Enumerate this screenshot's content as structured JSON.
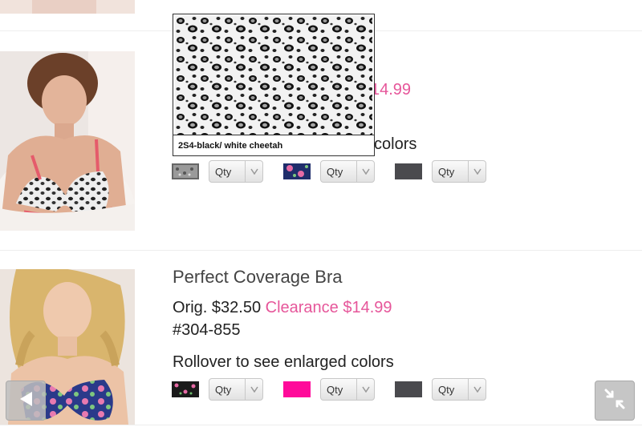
{
  "products": [
    {
      "title": "",
      "orig_price": "",
      "clearance_price": "14.99",
      "sku": "",
      "rollover_text": "colors",
      "qty_label": "Qty",
      "swatches": [
        {
          "name": "2S4-black/ white cheetah",
          "color": "#888888",
          "selected": true
        },
        {
          "name": "navy floral",
          "color": "#1f2d6b"
        },
        {
          "name": "charcoal",
          "color": "#4a4a4e"
        }
      ]
    },
    {
      "title": "Perfect Coverage Bra",
      "orig_price": "Orig. $32.50",
      "clearance_price": "Clearance $14.99",
      "sku": "#304-855",
      "rollover_text": "Rollover to see enlarged colors",
      "qty_label": "Qty",
      "swatches": [
        {
          "name": "black floral",
          "color": "#1a1a1a"
        },
        {
          "name": "hot pink",
          "color": "#ff0a9a"
        },
        {
          "name": "charcoal",
          "color": "#4a4a4e"
        }
      ]
    }
  ],
  "popup": {
    "caption": "2S4-black/ white cheetah"
  },
  "colors": {
    "clearance": "#e6569a",
    "divider": "#eeeeee",
    "button_gray": "#c6c6c6"
  },
  "icons": {
    "back": "left-triangle-icon",
    "collapse": "collapse-arrows-icon",
    "dropdown": "chevron-down-icon"
  }
}
